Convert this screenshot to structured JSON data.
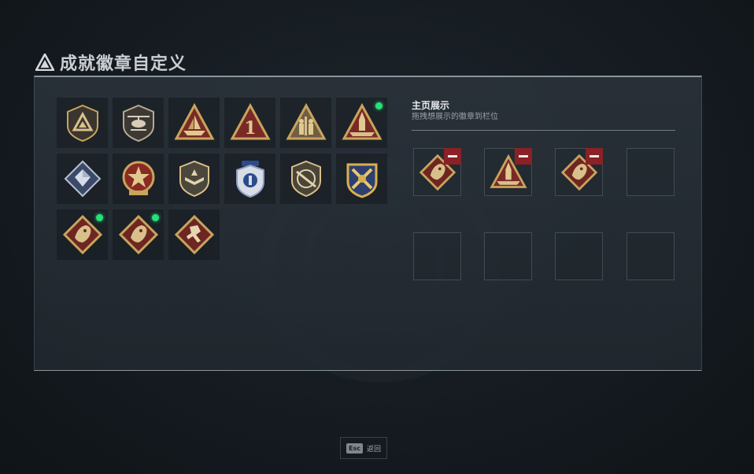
{
  "page": {
    "title": "成就徽章自定义",
    "title_icon": "triangle-logo-icon"
  },
  "badges": [
    {
      "name": "shield-triangle-badge",
      "new": false
    },
    {
      "name": "helicopter-badge",
      "new": false
    },
    {
      "name": "ship-triangle-badge",
      "new": false
    },
    {
      "name": "number-one-triangle-badge",
      "new": false
    },
    {
      "name": "soldiers-triangle-badge",
      "new": false
    },
    {
      "name": "rocket-triangle-badge",
      "new": true
    },
    {
      "name": "crystal-diamond-badge",
      "new": false
    },
    {
      "name": "red-star-medal-badge",
      "new": false
    },
    {
      "name": "wings-shield-badge",
      "new": false
    },
    {
      "name": "blue-police-badge",
      "new": false
    },
    {
      "name": "rifle-shield-badge",
      "new": false
    },
    {
      "name": "crossed-guns-crest-badge",
      "new": false
    },
    {
      "name": "dragon-diamond-badge",
      "new": true
    },
    {
      "name": "dragon-diamond-badge-2",
      "new": true
    },
    {
      "name": "runner-diamond-badge",
      "new": false
    }
  ],
  "showcase": {
    "title": "主页展示",
    "subtitle": "拖拽想展示的徽章到栏位",
    "slots": [
      {
        "badge": "dragon-diamond-badge",
        "filled": true
      },
      {
        "badge": "rocket-triangle-badge",
        "filled": true
      },
      {
        "badge": "dragon-diamond-badge",
        "filled": true
      },
      {
        "badge": "",
        "filled": false
      },
      {
        "badge": "",
        "filled": false
      },
      {
        "badge": "",
        "filled": false
      },
      {
        "badge": "",
        "filled": false
      },
      {
        "badge": "",
        "filled": false
      }
    ],
    "remove_icon": "minus-icon"
  },
  "footer": {
    "key": "Esc",
    "label": "返回"
  },
  "colors": {
    "accent_green": "#26e07a",
    "remove_red": "#8a2126",
    "badge_gold": "#c9a45c",
    "badge_red": "#7a2a26"
  }
}
